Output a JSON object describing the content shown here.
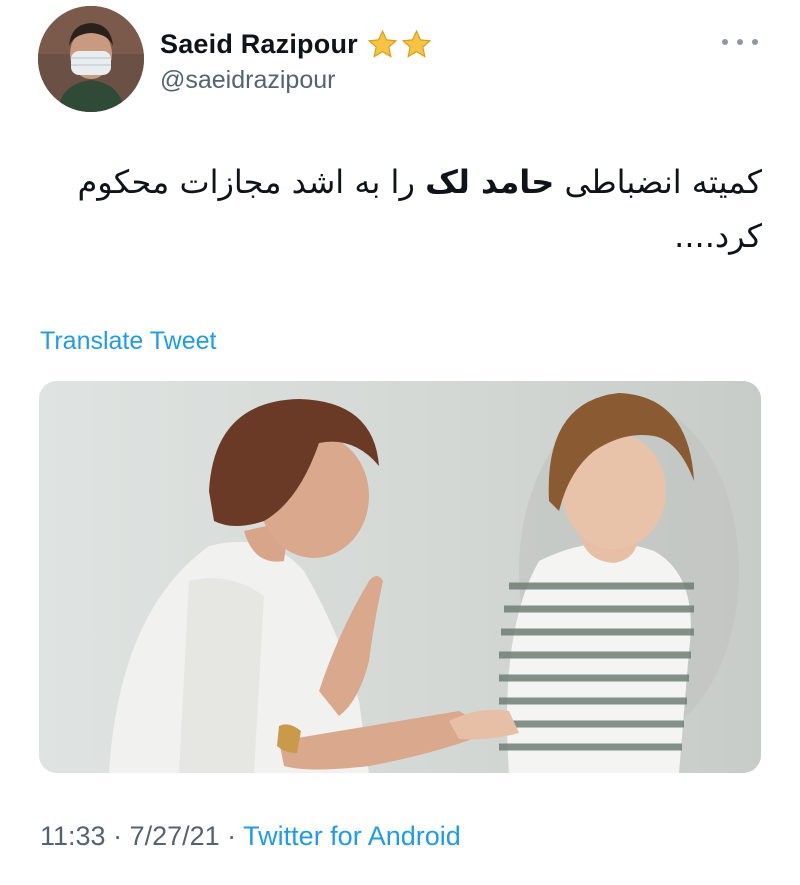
{
  "user": {
    "display_name": "Saeid Razipour",
    "handle": "@saeidrazipour",
    "badges": [
      "star-emoji",
      "star-emoji"
    ]
  },
  "tweet": {
    "text_before": "کمیته انضباطی",
    "text_bold": "حامد لک",
    "text_after": "را به اشد مجازات محکوم کرد....",
    "translate_label": "Translate Tweet"
  },
  "meta": {
    "time": "11:33",
    "separator_1": " · ",
    "date": "7/27/21",
    "separator_2": " · ",
    "source": "Twitter for Android"
  },
  "colors": {
    "link": "#1d9bf0",
    "secondary_text": "#536471",
    "star": "#f6c445"
  },
  "icons": {
    "more": "more-horizontal-icon"
  }
}
